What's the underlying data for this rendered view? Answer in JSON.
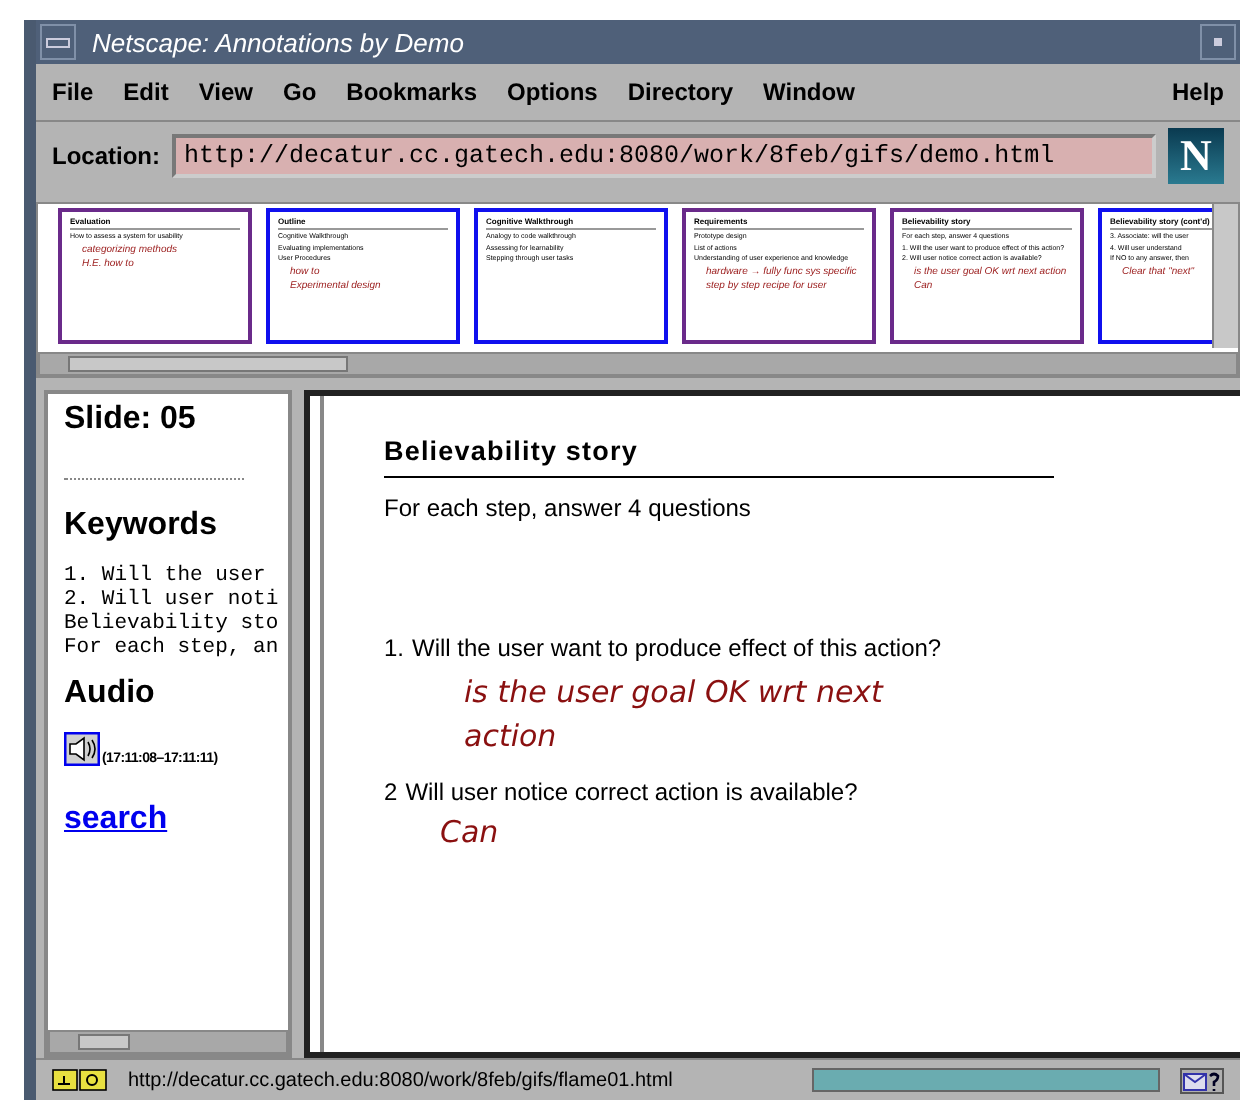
{
  "window": {
    "title": "Netscape: Annotations by Demo"
  },
  "menu": [
    "File",
    "Edit",
    "View",
    "Go",
    "Bookmarks",
    "Options",
    "Directory",
    "Window"
  ],
  "help_menu": "Help",
  "logo": "N",
  "location": {
    "label": "Location:",
    "value": "http://decatur.cc.gatech.edu:8080/work/8feb/gifs/demo.html"
  },
  "thumbnails": [
    {
      "title": "Evaluation",
      "lines": [
        "How to assess a system for usability"
      ],
      "notes": [
        "categorizing methods",
        "H.E. how to"
      ],
      "selected": false
    },
    {
      "title": "Outline",
      "lines": [
        "Cognitive Walkthrough",
        "Evaluating implementations",
        "User Procedures"
      ],
      "notes": [
        "how to",
        "Experimental design"
      ],
      "selected": true
    },
    {
      "title": "Cognitive Walkthrough",
      "lines": [
        "Analogy to code walkthrough",
        "Assessing for learnability",
        "Stepping through user tasks"
      ],
      "selected": true
    },
    {
      "title": "Requirements",
      "lines": [
        "Prototype design",
        "List of actions",
        "Understanding of user experience and knowledge"
      ],
      "notes": [
        "hardware → fully func sys specific",
        "step by step recipe for user"
      ],
      "selected": false
    },
    {
      "title": "Believability story",
      "lines": [
        "For each step, answer 4 questions",
        "1. Will the user want to produce effect of this action?",
        "2. Will user notice correct action is available?"
      ],
      "notes": [
        "is the user goal OK wrt next action",
        "Can"
      ],
      "selected": false
    },
    {
      "title": "Believability story (cont'd)",
      "lines": [
        "3. Associate: will the user",
        "4. Will user understand",
        "If NO to any answer, then"
      ],
      "notes": [
        "Clear that \"next\""
      ],
      "selected": true
    }
  ],
  "sidebar": {
    "slide": "Slide: 05",
    "keywords_heading": "Keywords",
    "keywords": [
      "1. Will the user",
      "2. Will user noti",
      "Believability sto",
      "For each step, an"
    ],
    "audio_heading": "Audio",
    "audio_time": "(17:11:08–17:11:11)",
    "search_link": "search"
  },
  "slide": {
    "title": "Believability story",
    "subtitle": "For each step, answer 4 questions",
    "questions": [
      {
        "number": "1.",
        "text": "Will the user want to produce effect of this action?",
        "note": "is the user goal OK wrt next action"
      },
      {
        "number": "2",
        "text": "Will user notice correct action is available?",
        "note": "Can"
      }
    ]
  },
  "status_bar": {
    "url": "http://decatur.cc.gatech.edu:8080/work/8feb/gifs/flame01.html",
    "level": 1
  }
}
